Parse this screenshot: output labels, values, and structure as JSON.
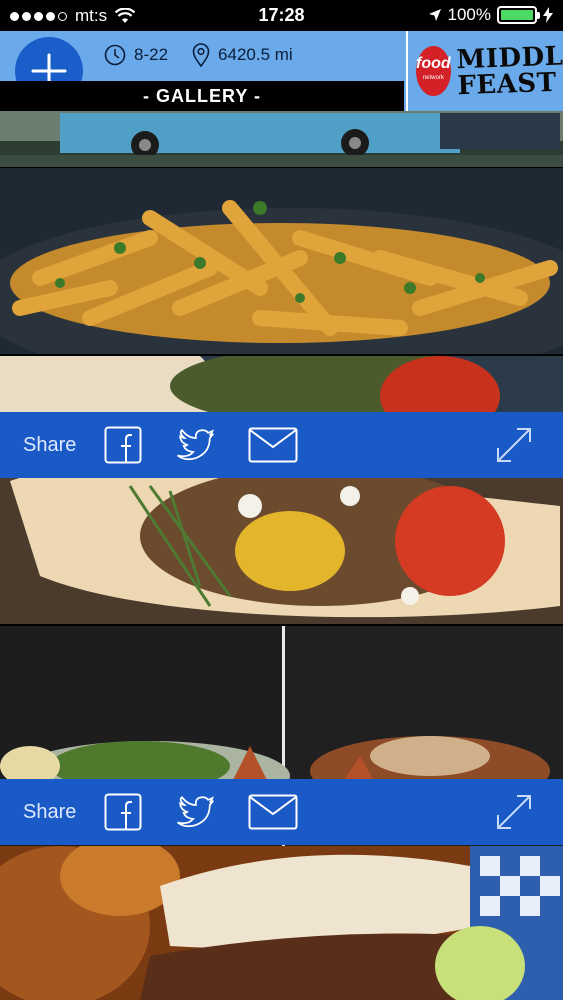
{
  "status_bar": {
    "carrier": "mt:s",
    "time": "17:28",
    "battery": "100%"
  },
  "header": {
    "hours": "8-22",
    "distance": "6420.5 mi",
    "gallery_label": "- GALLERY -",
    "brand": {
      "logo_text": "food",
      "logo_sub": "network",
      "name_line1": "MIDDLE",
      "name_line2": "FEAST"
    }
  },
  "share_bars": [
    {
      "label": "Share"
    },
    {
      "label": "Share"
    }
  ],
  "colors": {
    "header_bg": "#6aa9ea",
    "accent": "#1a5ac7",
    "gallery_bar": "#000000"
  }
}
